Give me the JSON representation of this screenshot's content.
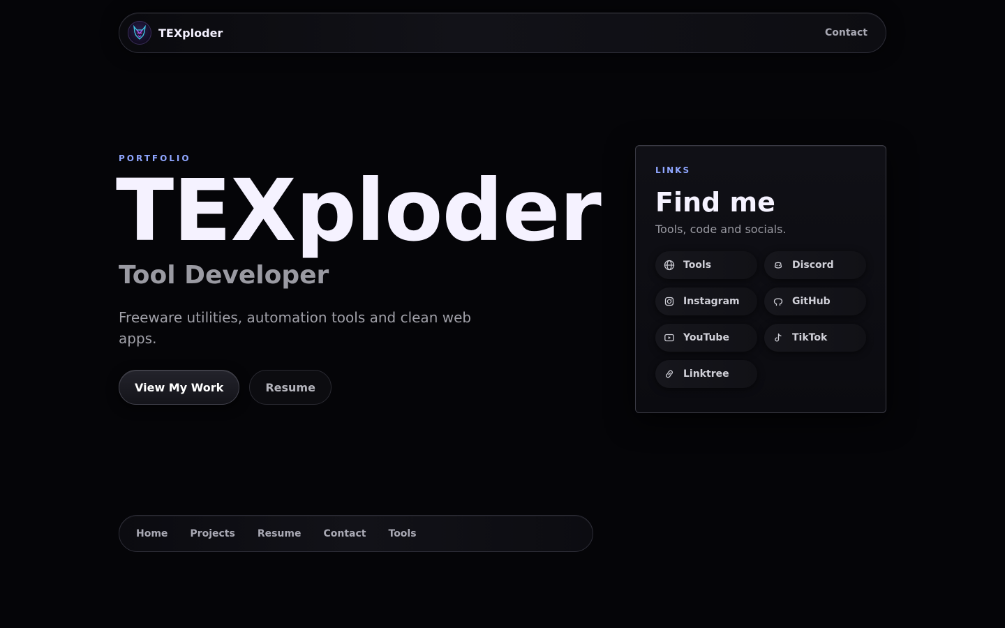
{
  "header": {
    "brand_name": "TEXploder",
    "logo_icon": "wolf-logo",
    "contact_label": "Contact"
  },
  "hero": {
    "eyebrow": "PORTFOLIO",
    "title": "TEXploder",
    "subtitle": "Tool Developer",
    "description": "Freeware utilities, automation tools and clean web apps.",
    "primary_button": "View My Work",
    "secondary_button": "Resume"
  },
  "links_card": {
    "eyebrow": "LINKS",
    "title": "Find me",
    "subtitle": "Tools, code and socials.",
    "links": [
      {
        "label": "Tools",
        "icon": "globe-icon"
      },
      {
        "label": "Discord",
        "icon": "discord-icon"
      },
      {
        "label": "Instagram",
        "icon": "instagram-icon"
      },
      {
        "label": "GitHub",
        "icon": "github-icon"
      },
      {
        "label": "YouTube",
        "icon": "youtube-icon"
      },
      {
        "label": "TikTok",
        "icon": "tiktok-icon"
      },
      {
        "label": "Linktree",
        "icon": "link-icon"
      }
    ]
  },
  "bottom_nav": {
    "items": [
      "Home",
      "Projects",
      "Resume",
      "Contact",
      "Tools"
    ]
  },
  "colors": {
    "background": "#050508",
    "accent": "#8fa6ff",
    "text_primary": "#f5f2ff",
    "text_muted": "#9a9aa2"
  }
}
